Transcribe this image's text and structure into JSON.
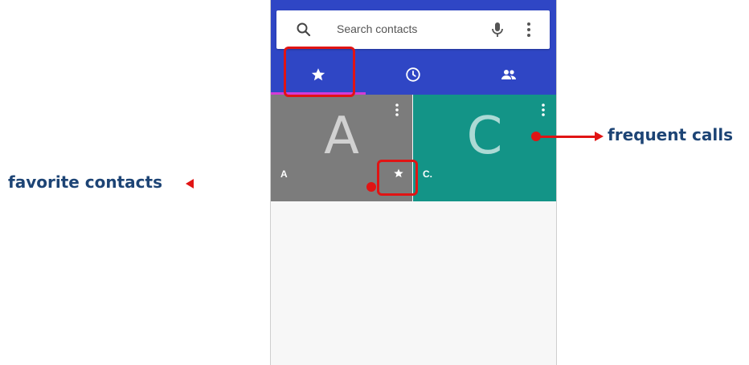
{
  "search": {
    "placeholder": "Search contacts",
    "icons": [
      "search-icon",
      "mic-icon",
      "more-vert-icon"
    ]
  },
  "tabs": [
    {
      "name": "favorites",
      "icon": "star-icon",
      "selected": true
    },
    {
      "name": "recents",
      "icon": "clock-icon",
      "selected": false
    },
    {
      "name": "contacts",
      "icon": "people-icon",
      "selected": false
    }
  ],
  "tiles": [
    {
      "initial": "A",
      "name": "A",
      "color": "#7c7c7c",
      "starred": true
    },
    {
      "initial": "C",
      "name": "C.",
      "color": "#139487",
      "starred": false
    }
  ],
  "annotations": {
    "favorite": "favorite contacts",
    "frequent": "frequent calls"
  },
  "colors": {
    "appbar": "#2f46c5",
    "tab_indicator": "#d43bd6",
    "annotation": "#e11414",
    "annotation_text": "#1d4475"
  }
}
